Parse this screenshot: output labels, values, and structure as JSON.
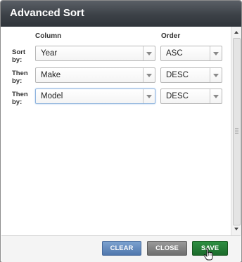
{
  "dialog": {
    "title": "Advanced Sort"
  },
  "headers": {
    "column": "Column",
    "order": "Order"
  },
  "rows": [
    {
      "label_line1": "Sort",
      "label_line2": "by:",
      "column": "Year",
      "order": "ASC"
    },
    {
      "label_line1": "Then",
      "label_line2": "by:",
      "column": "Make",
      "order": "DESC"
    },
    {
      "label_line1": "Then",
      "label_line2": "by:",
      "column": "Model",
      "order": "DESC"
    }
  ],
  "footer": {
    "clear_label": "CLEAR",
    "close_label": "CLOSE",
    "save_label": "SAVE"
  },
  "colors": {
    "title_bar": "#3c4147",
    "clear_button": "#5a81b6",
    "close_button": "#7e7e7e",
    "save_button": "#237a34"
  }
}
